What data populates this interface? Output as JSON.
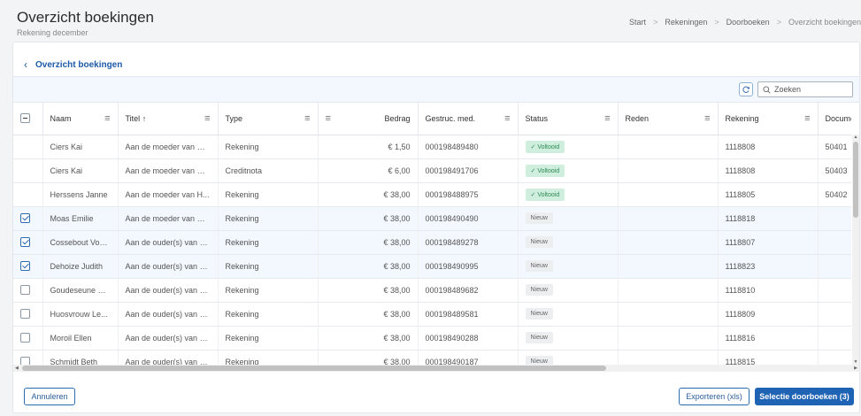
{
  "header": {
    "title": "Overzicht boekingen",
    "subtitle": "Rekening december",
    "breadcrumb": [
      "Start",
      "Rekeningen",
      "Doorboeken",
      "Overzicht boekingen"
    ]
  },
  "card": {
    "back_label": "Overzicht boekingen"
  },
  "toolbar": {
    "search_placeholder": "Zoeken"
  },
  "table": {
    "columns": [
      "Naam",
      "Titel",
      "Type",
      "Bedrag",
      "Gestruc. med.",
      "Status",
      "Reden",
      "Rekening",
      "Documer"
    ],
    "sort_indicator": "↑",
    "rows": [
      {
        "checked": null,
        "naam": "Ciers Kai",
        "titel": "Aan de moeder van Ci...",
        "type": "Rekening",
        "bedrag": "€ 1,50",
        "gestruc": "000198489480",
        "status": "Voltooid",
        "reden": "",
        "rekening": "1118808",
        "document": "50401"
      },
      {
        "checked": null,
        "naam": "Ciers Kai",
        "titel": "Aan de moeder van Ci...",
        "type": "Creditnota",
        "bedrag": "€ 6,00",
        "gestruc": "000198491706",
        "status": "Voltooid",
        "reden": "",
        "rekening": "1118808",
        "document": "50403"
      },
      {
        "checked": null,
        "naam": "Herssens Janne",
        "titel": "Aan de moeder van H...",
        "type": "Rekening",
        "bedrag": "€ 38,00",
        "gestruc": "000198488975",
        "status": "Voltooid",
        "reden": "",
        "rekening": "1118805",
        "document": "50402"
      },
      {
        "checked": true,
        "naam": "Moas Emilie",
        "titel": "Aan de moeder van M...",
        "type": "Rekening",
        "bedrag": "€ 38,00",
        "gestruc": "000198490490",
        "status": "Nieuw",
        "reden": "",
        "rekening": "1118818",
        "document": ""
      },
      {
        "checked": true,
        "naam": "Cossebout Von...",
        "titel": "Aan de ouder(s) van C...",
        "type": "Rekening",
        "bedrag": "€ 38,00",
        "gestruc": "000198489278",
        "status": "Nieuw",
        "reden": "",
        "rekening": "1118807",
        "document": ""
      },
      {
        "checked": true,
        "naam": "Dehoize Judith",
        "titel": "Aan de ouder(s) van D...",
        "type": "Rekening",
        "bedrag": "€ 38,00",
        "gestruc": "000198490995",
        "status": "Nieuw",
        "reden": "",
        "rekening": "1118823",
        "document": ""
      },
      {
        "checked": false,
        "naam": "Goudeseune Li...",
        "titel": "Aan de ouder(s) van G...",
        "type": "Rekening",
        "bedrag": "€ 38,00",
        "gestruc": "000198489682",
        "status": "Nieuw",
        "reden": "",
        "rekening": "1118810",
        "document": ""
      },
      {
        "checked": false,
        "naam": "Huosvrouw Le...",
        "titel": "Aan de ouder(s) van H...",
        "type": "Rekening",
        "bedrag": "€ 38,00",
        "gestruc": "000198489581",
        "status": "Nieuw",
        "reden": "",
        "rekening": "1118809",
        "document": ""
      },
      {
        "checked": false,
        "naam": "Moroil Ellen",
        "titel": "Aan de ouder(s) van M...",
        "type": "Rekening",
        "bedrag": "€ 38,00",
        "gestruc": "000198490288",
        "status": "Nieuw",
        "reden": "",
        "rekening": "1118816",
        "document": ""
      },
      {
        "checked": false,
        "naam": "Schmidt Beth",
        "titel": "Aan de ouder(s) van S...",
        "type": "Rekening",
        "bedrag": "€ 38,00",
        "gestruc": "000198490187",
        "status": "Nieuw",
        "reden": "",
        "rekening": "1118815",
        "document": ""
      }
    ]
  },
  "footer": {
    "cancel_label": "Annuleren",
    "export_label": "Exporteren (xls)",
    "submit_label": "Selectie doorboeken (3)"
  },
  "colors": {
    "primary": "#1f63b4",
    "success_bg": "#cfeedd",
    "success_text": "#2e8a55",
    "selected_row": "#f2f8fd"
  }
}
